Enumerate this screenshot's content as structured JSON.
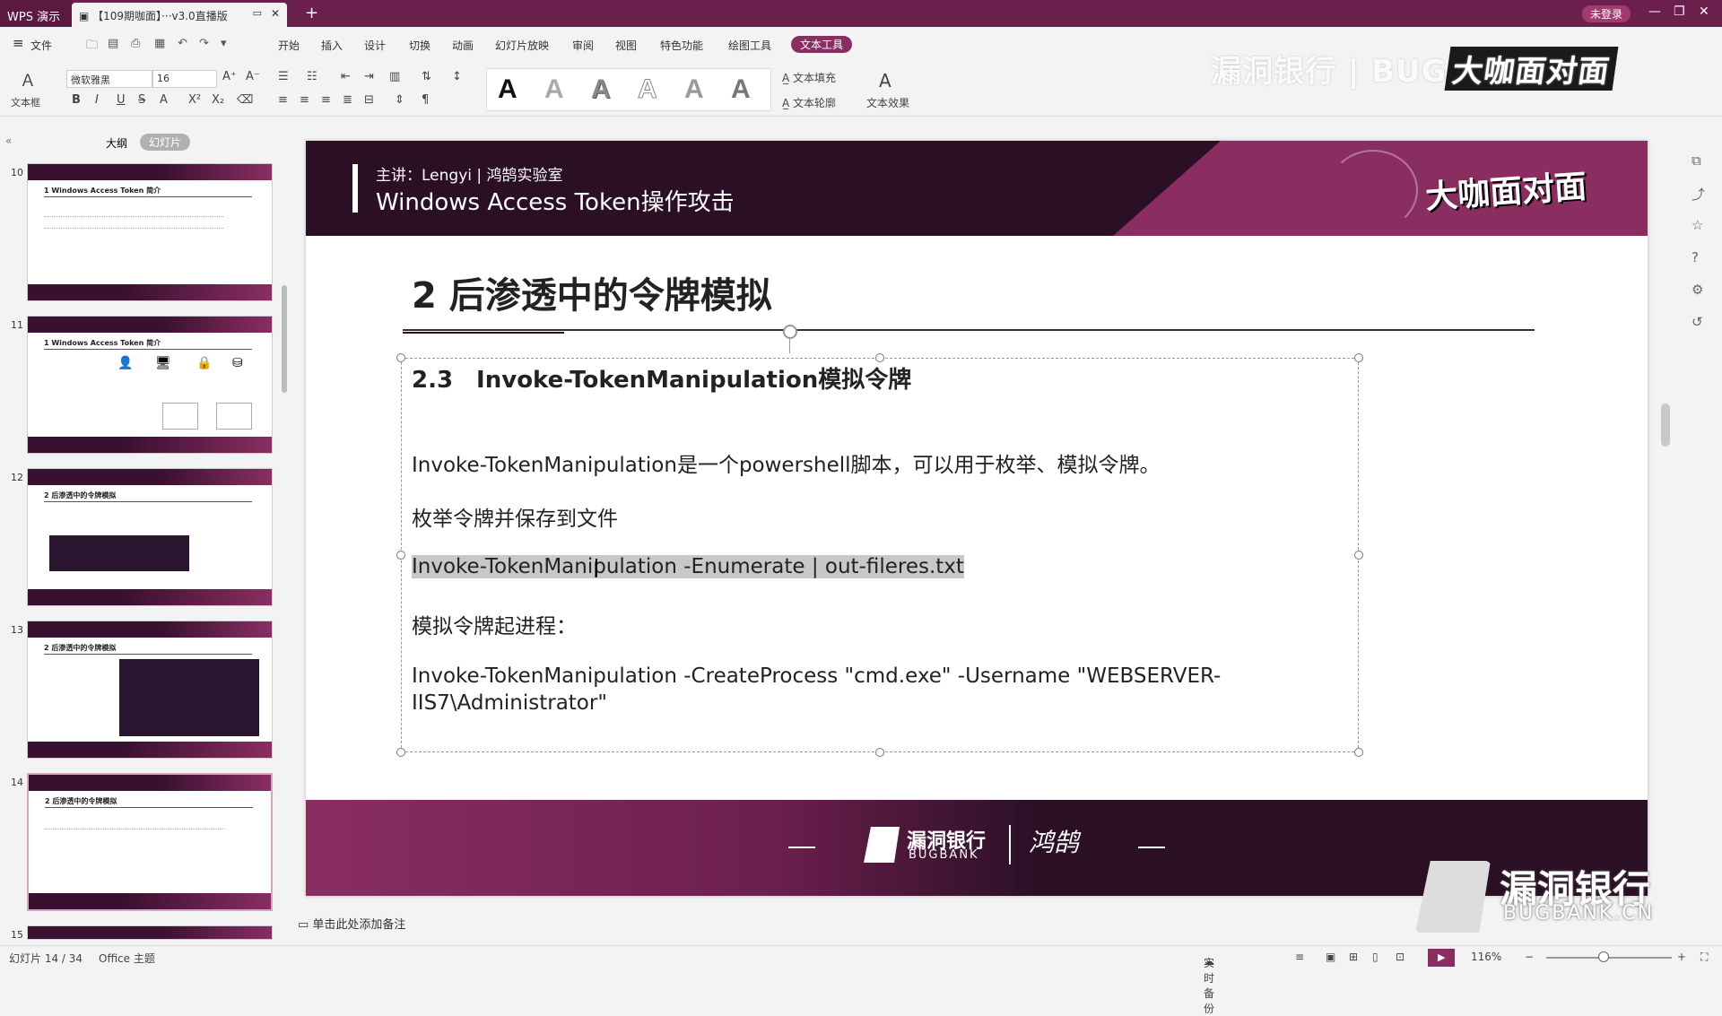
{
  "titlebar": {
    "app_name": "WPS 演示",
    "doc_title": "【109期咖面】···v3.0直播版",
    "login": "未登录"
  },
  "menu": {
    "file": "文件",
    "tabs": [
      "开始",
      "插入",
      "设计",
      "切换",
      "动画",
      "幻灯片放映",
      "审阅",
      "视图",
      "特色功能",
      "绘图工具"
    ],
    "active_tab": "文本工具"
  },
  "ribbon": {
    "textbox_label": "文本框",
    "font_name": "微软雅黑",
    "font_size": "16",
    "text_fill": "文本填充",
    "text_outline": "文本轮廓",
    "text_effect": "文本效果",
    "style_glyph": "A"
  },
  "watermark": {
    "top_left": "漏洞银行 | BUG",
    "top_right": "大咖面对面",
    "bottom_cn": "漏洞银行",
    "bottom_en": "BUGBANK.CN"
  },
  "left_panel": {
    "tab_outline": "大纲",
    "tab_slides": "幻灯片",
    "thumbnails": [
      {
        "num": "10",
        "title": "1 Windows Access Token 简介"
      },
      {
        "num": "11",
        "title": "1 Windows Access Token 简介"
      },
      {
        "num": "12",
        "title": "2 后渗透中的令牌模拟"
      },
      {
        "num": "13",
        "title": "2 后渗透中的令牌模拟"
      },
      {
        "num": "14",
        "title": "2 后渗透中的令牌模拟"
      },
      {
        "num": "15",
        "title": ""
      }
    ]
  },
  "slide": {
    "presenter": "主讲：Lengyi | 鸿鹄实验室",
    "course_title": "Windows Access Token操作攻击",
    "header_logo": "大咖面对面",
    "section_title": "2 后渗透中的令牌模拟",
    "subtitle": "2.3　Invoke-TokenManipulation模拟令牌",
    "line1": "Invoke-TokenManipulation是一个powershell脚本，可以用于枚举、模拟令牌。",
    "line2": "枚举令牌并保存到文件",
    "line3": "Invoke-TokenManipulation -Enumerate | out-fileres.txt",
    "line4": "模拟令牌起进程：",
    "line5": "Invoke-TokenManipulation -CreateProcess \"cmd.exe\" -Username \"WEBSERVER-IIS7\\Administrator\"",
    "footer_cn": "漏洞银行",
    "footer_en": "BUGBANK",
    "footer_sig": "鸿鹄"
  },
  "notes": {
    "placeholder": "单击此处添加备注"
  },
  "statusbar": {
    "slide_count": "幻灯片 14 / 34",
    "theme": "Office 主题",
    "backup": "实时备份",
    "zoom": "116%"
  },
  "colors": {
    "brand": "#6b1f4d",
    "accent": "#8a2e62",
    "dark": "#2a0f25"
  }
}
